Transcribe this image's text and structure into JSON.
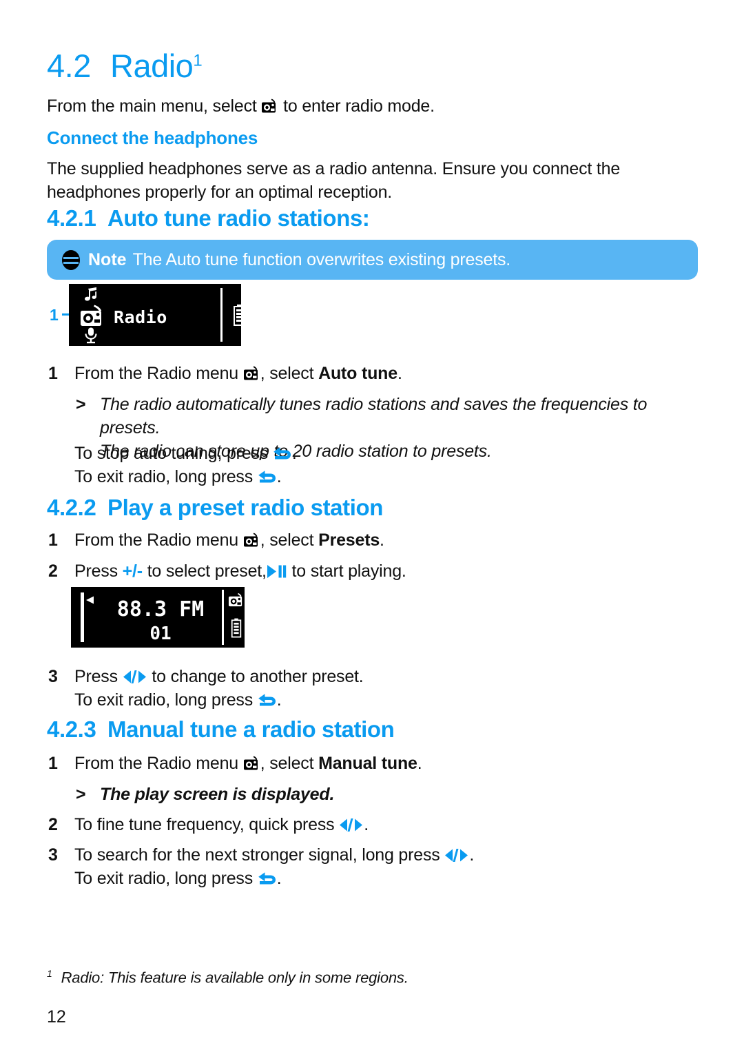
{
  "document": {
    "section_number": "4.2",
    "section_title": "Radio",
    "section_title_superscript": "1",
    "intro_before": "From the main menu, select",
    "intro_after": "to enter radio mode.",
    "page_number": "12",
    "footnote_marker": "1",
    "footnote_text": "Radio: This feature is available only in some regions."
  },
  "headphones": {
    "heading": "Connect the headphones",
    "body": "The supplied headphones serve as a radio antenna. Ensure you connect the headphones properly for an optimal reception."
  },
  "autotune": {
    "number": "4.2.1",
    "title": "Auto tune radio stations:",
    "note_label": "Note",
    "note_text": "The Auto tune function overwrites existing presets.",
    "step1_n": "1",
    "step1_a": "From the Radio menu",
    "step1_b": ", select",
    "step1_bold": "Auto tune",
    "step1_c": ".",
    "result_marker": ">",
    "result_line1": "The radio automatically tunes radio stations and saves the frequencies to presets.",
    "result_line2": "The radio can store up to 20 radio station to presets.",
    "stop_text": "To stop auto tuning, press",
    "exit_text": "To exit radio, long press",
    "period": "."
  },
  "lcd_menu": {
    "callout": "1",
    "label": "Radio",
    "icon_top": "music-note-icon",
    "icon_middle": "radio-icon",
    "icon_bottom": "microphone-icon",
    "icon_right": "battery-icon"
  },
  "presets": {
    "number": "4.2.2",
    "title": "Play a preset radio station",
    "step1_n": "1",
    "step1_a": "From the Radio menu",
    "step1_b": ", select",
    "step1_bold": "Presets",
    "step1_c": ".",
    "step2_n": "2",
    "step2_a": "Press",
    "step2_plusminus": "+/-",
    "step2_b": "to select preset,",
    "step2_c": "to start playing.",
    "step3_n": "3",
    "step3_a": "Press",
    "step3_b": "to change to another preset.",
    "step3_exit": "To exit radio, long press",
    "period": "."
  },
  "lcd_play": {
    "frequency": "88.3 FM",
    "preset_number": "01",
    "icon_radio": "radio-icon",
    "icon_battery": "battery-icon",
    "icon_scroll": "scrollbar-marker-icon"
  },
  "manual": {
    "number": "4.2.3",
    "title": "Manual tune a radio station",
    "step1_n": "1",
    "step1_a": "From the Radio menu",
    "step1_b": ", select",
    "step1_bold": "Manual tune",
    "step1_c": ".",
    "result_marker": ">",
    "result_text": "The play screen is displayed.",
    "step2_n": "2",
    "step2_a": "To fine tune frequency, quick press",
    "step3_n": "3",
    "step3_a": "To search for the next stronger signal, long press",
    "step3_exit": "To exit radio, long press",
    "period": "."
  },
  "colors": {
    "accent_blue": "#0A9BF0",
    "note_bg": "#58B5F3",
    "lcd_bg": "#000000",
    "text": "#111111"
  }
}
